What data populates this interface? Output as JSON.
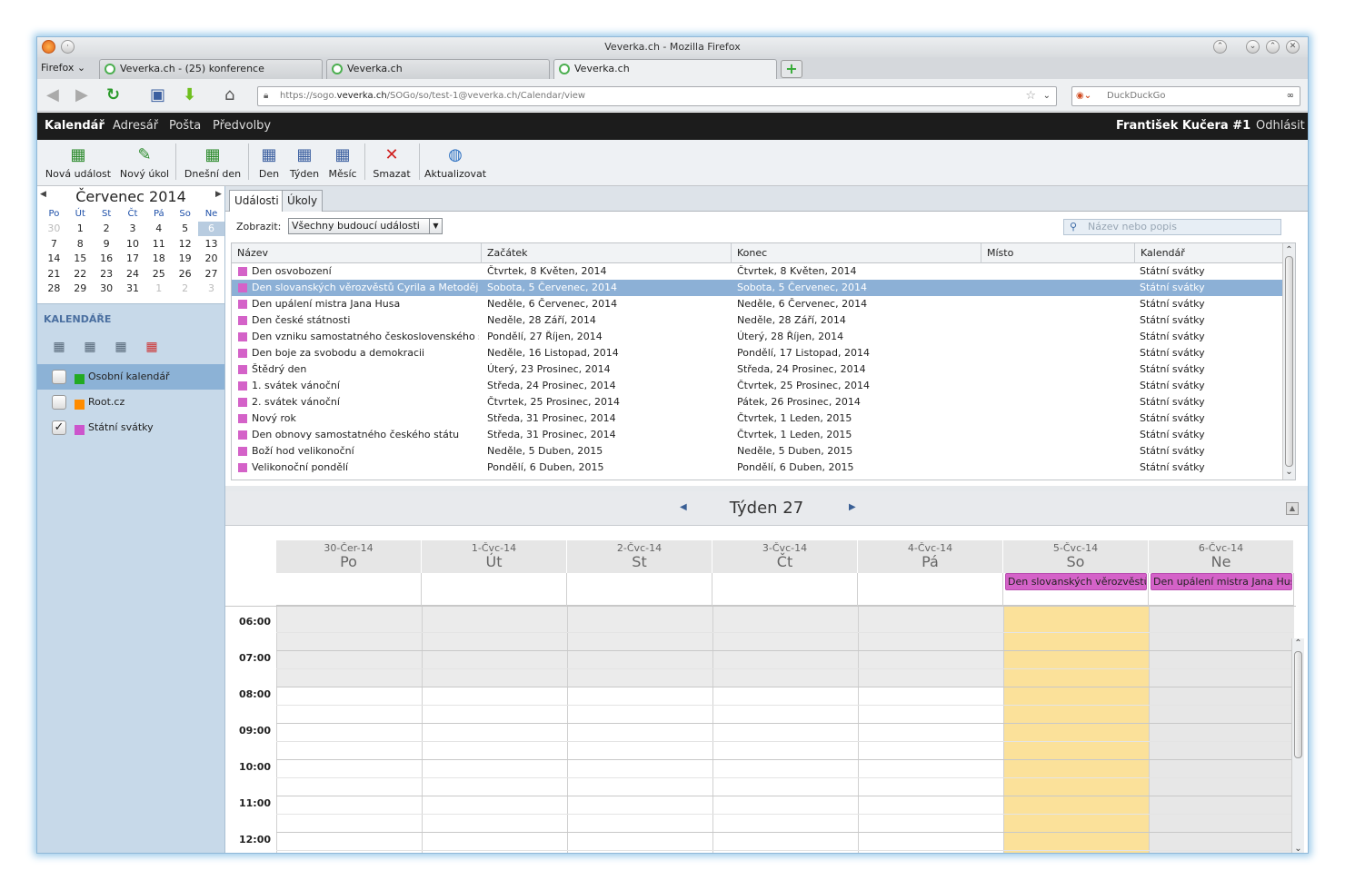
{
  "window": {
    "title": "Veverka.ch - Mozilla Firefox"
  },
  "browser": {
    "menu_label": "Firefox",
    "tabs": [
      {
        "label": "Veverka.ch - (25) konference"
      },
      {
        "label": "Veverka.ch"
      },
      {
        "label": "Veverka.ch"
      }
    ],
    "url_prefix": "https://sogo.",
    "url_host": "veverka.ch",
    "url_path": "/SOGo/so/test-1@veverka.ch/Calendar/view",
    "search_placeholder": "DuckDuckGo"
  },
  "app": {
    "nav": [
      "Kalendář",
      "Adresář",
      "Pošta",
      "Předvolby"
    ],
    "user": "František Kučera #1",
    "logout": "Odhlásit"
  },
  "toolbar": {
    "new_event": "Nová událost",
    "new_task": "Nový úkol",
    "today": "Dnešní den",
    "day": "Den",
    "week": "Týden",
    "month": "Měsíc",
    "delete": "Smazat",
    "refresh": "Aktualizovat"
  },
  "minical": {
    "month": "Červenec",
    "year": "2014",
    "weekdays": [
      "Po",
      "Út",
      "St",
      "Čt",
      "Pá",
      "So",
      "Ne"
    ],
    "weeks": [
      [
        "30",
        "1",
        "2",
        "3",
        "4",
        "5",
        "6"
      ],
      [
        "7",
        "8",
        "9",
        "10",
        "11",
        "12",
        "13"
      ],
      [
        "14",
        "15",
        "16",
        "17",
        "18",
        "19",
        "20"
      ],
      [
        "21",
        "22",
        "23",
        "24",
        "25",
        "26",
        "27"
      ],
      [
        "28",
        "29",
        "30",
        "31",
        "1",
        "2",
        "3"
      ]
    ]
  },
  "calendars": {
    "title": "KALENDÁŘE",
    "items": [
      {
        "name": "Osobní kalendář",
        "color": "#22aa22",
        "checked": false
      },
      {
        "name": "Root.cz",
        "color": "#ff8c00",
        "checked": false
      },
      {
        "name": "Státní svátky",
        "color": "#cc55cc",
        "checked": true
      }
    ]
  },
  "tabs": {
    "events": "Události",
    "tasks": "Úkoly"
  },
  "filter": {
    "label": "Zobrazit:",
    "value": "Všechny budoucí události",
    "search_placeholder": "Název nebo popis"
  },
  "event_columns": [
    "Název",
    "Začátek",
    "Konec",
    "Místo",
    "Kalendář"
  ],
  "events": [
    {
      "name": "Den osvobození",
      "start": "Čtvrtek, 8 Květen, 2014",
      "end": "Čtvrtek, 8 Květen, 2014",
      "place": "",
      "calendar": "Státní svátky"
    },
    {
      "name": "Den slovanských věrozvěstů Cyrila a Metoděje",
      "start": "Sobota, 5 Červenec, 2014",
      "end": "Sobota, 5 Červenec, 2014",
      "place": "",
      "calendar": "Státní svátky"
    },
    {
      "name": "Den upálení mistra Jana Husa",
      "start": "Neděle, 6 Červenec, 2014",
      "end": "Neděle, 6 Červenec, 2014",
      "place": "",
      "calendar": "Státní svátky"
    },
    {
      "name": "Den české státnosti",
      "start": "Neděle, 28 Září, 2014",
      "end": "Neděle, 28 Září, 2014",
      "place": "",
      "calendar": "Státní svátky"
    },
    {
      "name": "Den vzniku samostatného československého státu",
      "start": "Pondělí, 27 Říjen, 2014",
      "end": "Úterý, 28 Říjen, 2014",
      "place": "",
      "calendar": "Státní svátky"
    },
    {
      "name": "Den boje za svobodu a demokracii",
      "start": "Neděle, 16 Listopad, 2014",
      "end": "Pondělí, 17 Listopad, 2014",
      "place": "",
      "calendar": "Státní svátky"
    },
    {
      "name": "Štědrý den",
      "start": "Úterý, 23 Prosinec, 2014",
      "end": "Středa, 24 Prosinec, 2014",
      "place": "",
      "calendar": "Státní svátky"
    },
    {
      "name": "1. svátek vánoční",
      "start": "Středa, 24 Prosinec, 2014",
      "end": "Čtvrtek, 25 Prosinec, 2014",
      "place": "",
      "calendar": "Státní svátky"
    },
    {
      "name": "2. svátek vánoční",
      "start": "Čtvrtek, 25 Prosinec, 2014",
      "end": "Pátek, 26 Prosinec, 2014",
      "place": "",
      "calendar": "Státní svátky"
    },
    {
      "name": "Nový rok",
      "start": "Středa, 31 Prosinec, 2014",
      "end": "Čtvrtek, 1 Leden, 2015",
      "place": "",
      "calendar": "Státní svátky"
    },
    {
      "name": "Den obnovy samostatného českého státu",
      "start": "Středa, 31 Prosinec, 2014",
      "end": "Čtvrtek, 1 Leden, 2015",
      "place": "",
      "calendar": "Státní svátky"
    },
    {
      "name": "Boží hod velikonoční",
      "start": "Neděle, 5 Duben, 2015",
      "end": "Neděle, 5 Duben, 2015",
      "place": "",
      "calendar": "Státní svátky"
    },
    {
      "name": "Velikonoční pondělí",
      "start": "Pondělí, 6 Duben, 2015",
      "end": "Pondělí, 6 Duben, 2015",
      "place": "",
      "calendar": "Státní svátky"
    }
  ],
  "week": {
    "title": "Týden 27",
    "days": [
      {
        "date": "30-Čer-14",
        "name": "Po"
      },
      {
        "date": "1-Čvc-14",
        "name": "Út"
      },
      {
        "date": "2-Čvc-14",
        "name": "St"
      },
      {
        "date": "3-Čvc-14",
        "name": "Čt"
      },
      {
        "date": "4-Čvc-14",
        "name": "Pá"
      },
      {
        "date": "5-Čvc-14",
        "name": "So"
      },
      {
        "date": "6-Čvc-14",
        "name": "Ne"
      }
    ],
    "allday_events": [
      {
        "day": 5,
        "title": "Den slovanských věrozvěstů"
      },
      {
        "day": 6,
        "title": "Den upálení mistra Jana Husa"
      }
    ],
    "hours": [
      "06:00",
      "07:00",
      "08:00",
      "09:00",
      "10:00",
      "11:00",
      "12:00"
    ]
  },
  "colors": {
    "event": "#d462c8",
    "today_column": "#fbe19a",
    "selection": "#8cb0d6",
    "appbar": "#1c1c1c"
  }
}
